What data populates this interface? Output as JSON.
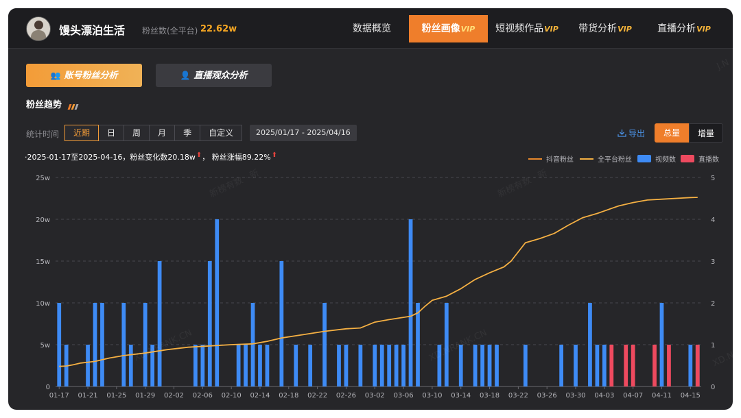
{
  "header": {
    "account_name": "馒头漂泊生活",
    "fans_label": "粉丝数(全平台)",
    "fans_value": "22.62w",
    "nav": [
      {
        "label": "数据概览",
        "vip": ""
      },
      {
        "label": "粉丝画像",
        "vip": "VIP",
        "active": true
      },
      {
        "label": "短视频作品",
        "vip": "VIP"
      },
      {
        "label": "带货分析",
        "vip": "VIP"
      },
      {
        "label": "直播分析",
        "vip": "VIP"
      }
    ]
  },
  "subtabs": [
    {
      "label": "账号粉丝分析",
      "active": true
    },
    {
      "label": "直播观众分析",
      "active": false
    }
  ],
  "section_title": "粉丝趋势",
  "filters": {
    "stat_label": "统计时间",
    "ranges": [
      "近期",
      "日",
      "周",
      "月",
      "季",
      "自定义"
    ],
    "active_range": "近期",
    "date_range": "2025/01/17  -  2025/04/16",
    "export_label": "导出",
    "modes": [
      "总量",
      "增量"
    ],
    "active_mode": "总量"
  },
  "summary": {
    "prefix": "·2025-01-17至2025-04-16，粉丝变化数20.18w",
    "middle": "，  粉丝涨幅89.22%"
  },
  "watermarks": [
    "新榜有数 · 新",
    "新榜有数 · 新",
    "XD.NRANK.CN",
    "XD.NRANK.CN",
    "J.N",
    "XD.N"
  ],
  "colors": {
    "accent": "#ef7e2b",
    "douyin_line": "#e8892b",
    "all_platform_line": "#f5b043",
    "video_bar": "#3e8bf5",
    "live_bar": "#ee4a5f",
    "panel_bg": "#262629"
  },
  "chart_data": {
    "type": "bar",
    "legend": [
      "抖音粉丝",
      "全平台粉丝",
      "视频数",
      "直播数"
    ],
    "x_tick_labels": [
      "01-17",
      "01-21",
      "01-25",
      "01-29",
      "02-02",
      "02-06",
      "02-10",
      "02-14",
      "02-18",
      "02-22",
      "02-26",
      "03-02",
      "03-06",
      "03-10",
      "03-14",
      "03-18",
      "03-22",
      "03-26",
      "03-30",
      "04-03",
      "04-07",
      "04-11",
      "04-15"
    ],
    "y_left": {
      "ticks": [
        "0",
        "5w",
        "10w",
        "15w",
        "20w",
        "25w"
      ],
      "range": [
        0,
        25
      ]
    },
    "y_right": {
      "ticks": [
        "0",
        "1",
        "2",
        "3",
        "4",
        "5"
      ],
      "range": [
        0,
        5
      ]
    },
    "start_date": "01-17",
    "num_days": 90,
    "fans_series": [
      {
        "x": "01-17",
        "y": 2.4
      },
      {
        "x": "01-18",
        "y": 2.45
      },
      {
        "x": "01-19",
        "y": 2.6
      },
      {
        "x": "01-20",
        "y": 2.8
      },
      {
        "x": "01-22",
        "y": 3.0
      },
      {
        "x": "01-24",
        "y": 3.4
      },
      {
        "x": "01-26",
        "y": 3.7
      },
      {
        "x": "01-29",
        "y": 4.0
      },
      {
        "x": "02-01",
        "y": 4.4
      },
      {
        "x": "02-04",
        "y": 4.7
      },
      {
        "x": "02-07",
        "y": 4.85
      },
      {
        "x": "02-10",
        "y": 5.0
      },
      {
        "x": "02-13",
        "y": 5.1
      },
      {
        "x": "02-15",
        "y": 5.4
      },
      {
        "x": "02-17",
        "y": 5.8
      },
      {
        "x": "02-20",
        "y": 6.2
      },
      {
        "x": "02-23",
        "y": 6.6
      },
      {
        "x": "02-26",
        "y": 6.9
      },
      {
        "x": "02-28",
        "y": 7.0
      },
      {
        "x": "03-02",
        "y": 7.7
      },
      {
        "x": "03-04",
        "y": 8.0
      },
      {
        "x": "03-07",
        "y": 8.4
      },
      {
        "x": "03-08",
        "y": 8.8
      },
      {
        "x": "03-09",
        "y": 9.6
      },
      {
        "x": "03-10",
        "y": 10.3
      },
      {
        "x": "03-12",
        "y": 10.8
      },
      {
        "x": "03-14",
        "y": 11.7
      },
      {
        "x": "03-16",
        "y": 12.8
      },
      {
        "x": "03-18",
        "y": 13.6
      },
      {
        "x": "03-20",
        "y": 14.3
      },
      {
        "x": "03-21",
        "y": 15.0
      },
      {
        "x": "03-23",
        "y": 17.2
      },
      {
        "x": "03-25",
        "y": 17.7
      },
      {
        "x": "03-27",
        "y": 18.3
      },
      {
        "x": "03-29",
        "y": 19.3
      },
      {
        "x": "03-31",
        "y": 20.2
      },
      {
        "x": "04-02",
        "y": 20.7
      },
      {
        "x": "04-03",
        "y": 21.0
      },
      {
        "x": "04-05",
        "y": 21.6
      },
      {
        "x": "04-07",
        "y": 22.0
      },
      {
        "x": "04-09",
        "y": 22.3
      },
      {
        "x": "04-11",
        "y": 22.4
      },
      {
        "x": "04-13",
        "y": 22.5
      },
      {
        "x": "04-15",
        "y": 22.6
      },
      {
        "x": "04-16",
        "y": 22.62
      }
    ],
    "video_series": [
      {
        "x": "01-17",
        "y": 2
      },
      {
        "x": "01-18",
        "y": 1
      },
      {
        "x": "01-21",
        "y": 1
      },
      {
        "x": "01-22",
        "y": 2
      },
      {
        "x": "01-23",
        "y": 2
      },
      {
        "x": "01-26",
        "y": 2
      },
      {
        "x": "01-27",
        "y": 1
      },
      {
        "x": "01-29",
        "y": 2
      },
      {
        "x": "01-30",
        "y": 1
      },
      {
        "x": "01-31",
        "y": 3
      },
      {
        "x": "02-05",
        "y": 1
      },
      {
        "x": "02-06",
        "y": 1
      },
      {
        "x": "02-07",
        "y": 3
      },
      {
        "x": "02-08",
        "y": 4
      },
      {
        "x": "02-11",
        "y": 1
      },
      {
        "x": "02-12",
        "y": 1
      },
      {
        "x": "02-13",
        "y": 2
      },
      {
        "x": "02-14",
        "y": 1
      },
      {
        "x": "02-15",
        "y": 1
      },
      {
        "x": "02-17",
        "y": 3
      },
      {
        "x": "02-19",
        "y": 1
      },
      {
        "x": "02-21",
        "y": 1
      },
      {
        "x": "02-23",
        "y": 2
      },
      {
        "x": "02-25",
        "y": 1
      },
      {
        "x": "02-26",
        "y": 1
      },
      {
        "x": "02-28",
        "y": 1
      },
      {
        "x": "03-02",
        "y": 1
      },
      {
        "x": "03-03",
        "y": 1
      },
      {
        "x": "03-04",
        "y": 1
      },
      {
        "x": "03-05",
        "y": 1
      },
      {
        "x": "03-06",
        "y": 1
      },
      {
        "x": "03-07",
        "y": 4
      },
      {
        "x": "03-08",
        "y": 2
      },
      {
        "x": "03-11",
        "y": 1
      },
      {
        "x": "03-12",
        "y": 2
      },
      {
        "x": "03-14",
        "y": 1
      },
      {
        "x": "03-16",
        "y": 1
      },
      {
        "x": "03-17",
        "y": 1
      },
      {
        "x": "03-18",
        "y": 1
      },
      {
        "x": "03-19",
        "y": 1
      },
      {
        "x": "03-23",
        "y": 1
      },
      {
        "x": "03-28",
        "y": 1
      },
      {
        "x": "03-30",
        "y": 1
      },
      {
        "x": "04-01",
        "y": 2
      },
      {
        "x": "04-02",
        "y": 1
      },
      {
        "x": "04-03",
        "y": 1
      },
      {
        "x": "04-11",
        "y": 2
      },
      {
        "x": "04-15",
        "y": 1
      },
      {
        "x": "04-16",
        "y": 1
      }
    ],
    "live_series": [
      {
        "x": "04-04",
        "y": 1
      },
      {
        "x": "04-06",
        "y": 1
      },
      {
        "x": "04-07",
        "y": 1
      },
      {
        "x": "04-10",
        "y": 1
      },
      {
        "x": "04-12",
        "y": 1
      },
      {
        "x": "04-16",
        "y": 1
      }
    ]
  }
}
